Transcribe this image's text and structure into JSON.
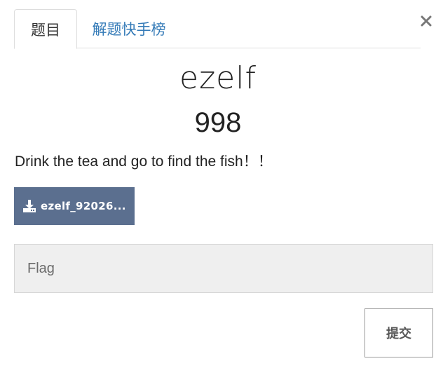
{
  "tabs": [
    {
      "label": "题目",
      "active": true
    },
    {
      "label": "解题快手榜",
      "active": false
    }
  ],
  "challenge": {
    "name": "ezelf",
    "value": "998",
    "description": "Drink the tea and go to find the fish！！"
  },
  "file": {
    "label": "ezelf_92026...",
    "icon": "download-icon"
  },
  "flag": {
    "placeholder": "Flag",
    "value": ""
  },
  "submit_label": "提交",
  "close_icon": "close-icon",
  "colors": {
    "file_button": "#5b6f8f",
    "tab_link": "#337ab7",
    "input_bg": "#efefef"
  }
}
